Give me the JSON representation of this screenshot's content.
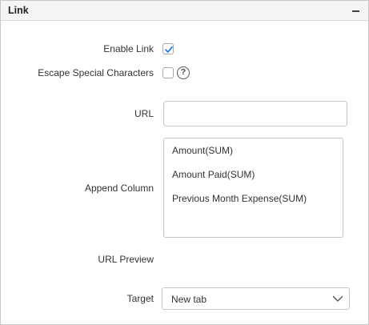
{
  "panel": {
    "title": "Link"
  },
  "form": {
    "enable_link": {
      "label": "Enable Link",
      "checked": true
    },
    "escape_special": {
      "label": "Escape Special Characters",
      "checked": false
    },
    "url": {
      "label": "URL",
      "value": "",
      "placeholder": ""
    },
    "append_column": {
      "label": "Append Column",
      "items": [
        "Amount(SUM)",
        "Amount Paid(SUM)",
        "Previous Month Expense(SUM)"
      ]
    },
    "url_preview": {
      "label": "URL Preview"
    },
    "target": {
      "label": "Target",
      "value": "New tab"
    }
  },
  "icons": {
    "collapse": "minus-icon",
    "help": "question-circle-icon",
    "check": "checkmark-icon",
    "dropdown": "chevron-down-icon"
  },
  "colors": {
    "accent": "#1a73e8",
    "border": "#c6c6c6",
    "header_bg": "#f5f5f5"
  }
}
